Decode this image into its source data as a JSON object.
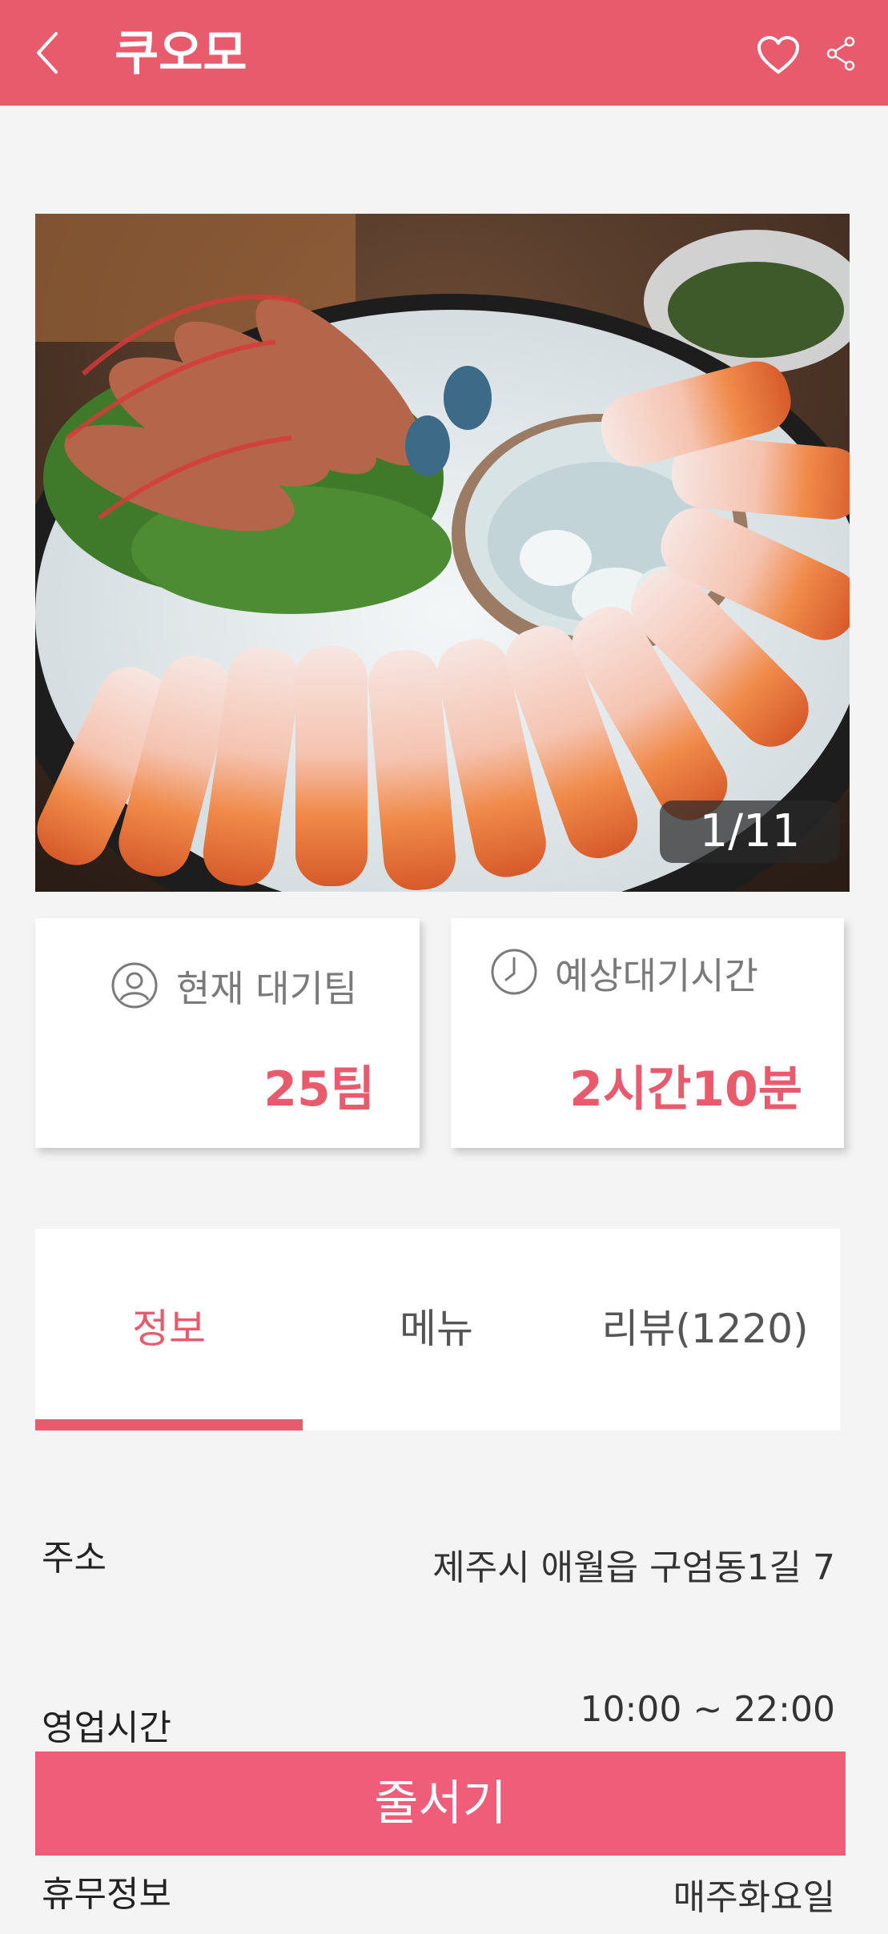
{
  "header": {
    "title": "쿠오모"
  },
  "gallery": {
    "counter": "1/11"
  },
  "stats": {
    "waiting_teams": {
      "label": "현재 대기팀",
      "value": "25팀"
    },
    "wait_time": {
      "label": "예상대기시간",
      "value": "2시간10분"
    }
  },
  "tabs": [
    {
      "label": "정보",
      "active": true
    },
    {
      "label": "메뉴",
      "active": false
    },
    {
      "label": "리뷰(1220)",
      "active": false
    }
  ],
  "info": {
    "address": {
      "label": "주소",
      "value": "제주시 애월읍 구엄동1길 7"
    },
    "hours": {
      "label": "영업시간",
      "value": "10:00 ~ 22:00"
    },
    "closed": {
      "label": "휴무정보",
      "value": "매주화요일"
    }
  },
  "cta": {
    "label": "줄서기"
  },
  "colors": {
    "accent": "#e85b6c",
    "cta": "#ef5d78",
    "background": "#f4f4f4"
  }
}
